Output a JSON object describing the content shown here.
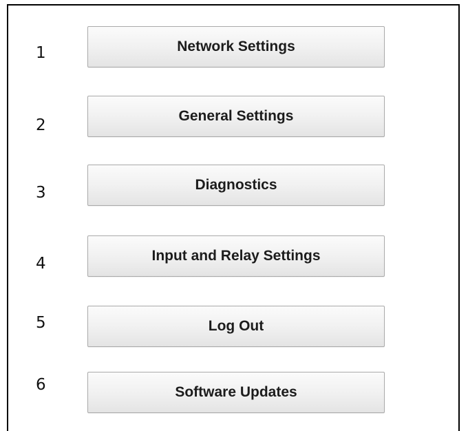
{
  "menu": {
    "items": [
      {
        "number": "1",
        "label": "Network Settings"
      },
      {
        "number": "2",
        "label": "General Settings"
      },
      {
        "number": "3",
        "label": "Diagnostics"
      },
      {
        "number": "4",
        "label": "Input and Relay Settings"
      },
      {
        "number": "5",
        "label": "Log Out"
      },
      {
        "number": "6",
        "label": "Software Updates"
      }
    ]
  }
}
